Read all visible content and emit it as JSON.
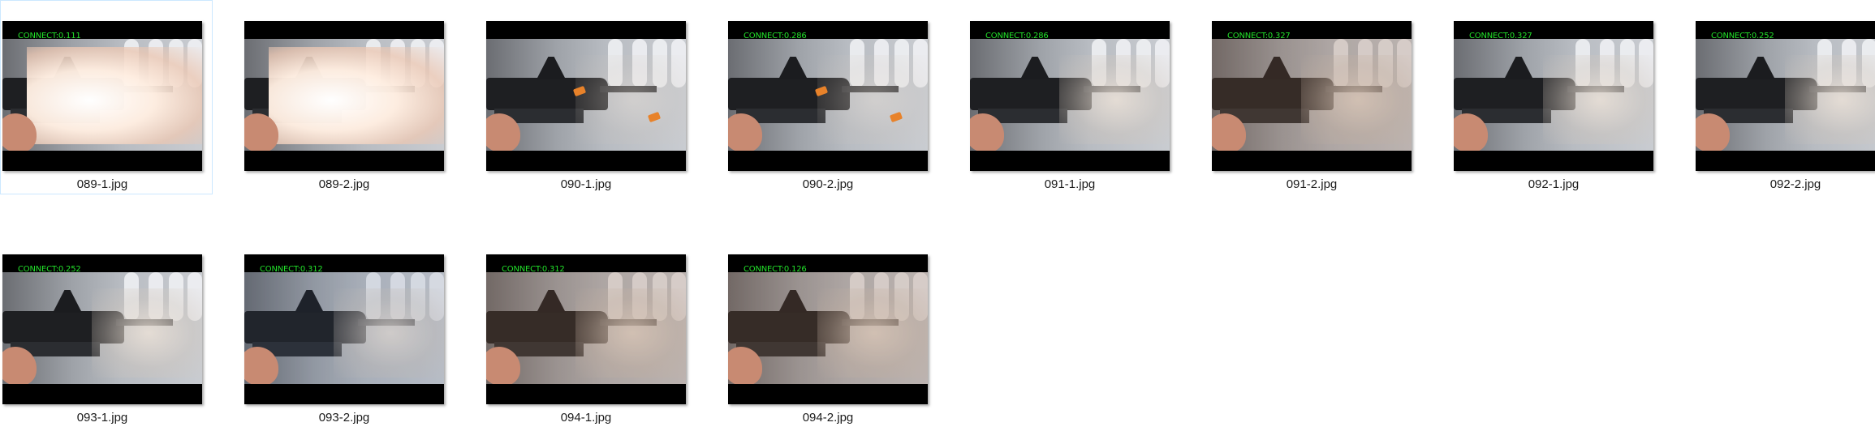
{
  "files": [
    {
      "name": "089-1.jpg",
      "overlay": "CONNECT:0.111",
      "scene": "flash",
      "selected": true
    },
    {
      "name": "089-2.jpg",
      "overlay": "",
      "scene": "flash",
      "selected": false
    },
    {
      "name": "090-1.jpg",
      "overlay": "",
      "scene": "ember",
      "selected": false
    },
    {
      "name": "090-2.jpg",
      "overlay": "CONNECT:0.286",
      "scene": "ember",
      "selected": false
    },
    {
      "name": "091-1.jpg",
      "overlay": "CONNECT:0.286",
      "scene": "smoke",
      "selected": false
    },
    {
      "name": "091-2.jpg",
      "overlay": "CONNECT:0.327",
      "scene": "smoke-warm",
      "selected": false
    },
    {
      "name": "092-1.jpg",
      "overlay": "CONNECT:0.327",
      "scene": "smoke",
      "selected": false
    },
    {
      "name": "092-2.jpg",
      "overlay": "CONNECT:0.252",
      "scene": "smoke",
      "selected": false
    },
    {
      "name": "093-1.jpg",
      "overlay": "CONNECT:0.252",
      "scene": "smoke",
      "selected": false
    },
    {
      "name": "093-2.jpg",
      "overlay": "CONNECT:0.312",
      "scene": "smoke-cool",
      "selected": false
    },
    {
      "name": "094-1.jpg",
      "overlay": "CONNECT:0.312",
      "scene": "smoke-warm",
      "selected": false
    },
    {
      "name": "094-2.jpg",
      "overlay": "CONNECT:0.126",
      "scene": "smoke-warm",
      "selected": false
    }
  ],
  "colors": {
    "overlay_text": "#22e22a",
    "selection_border": "#cce8ff"
  }
}
